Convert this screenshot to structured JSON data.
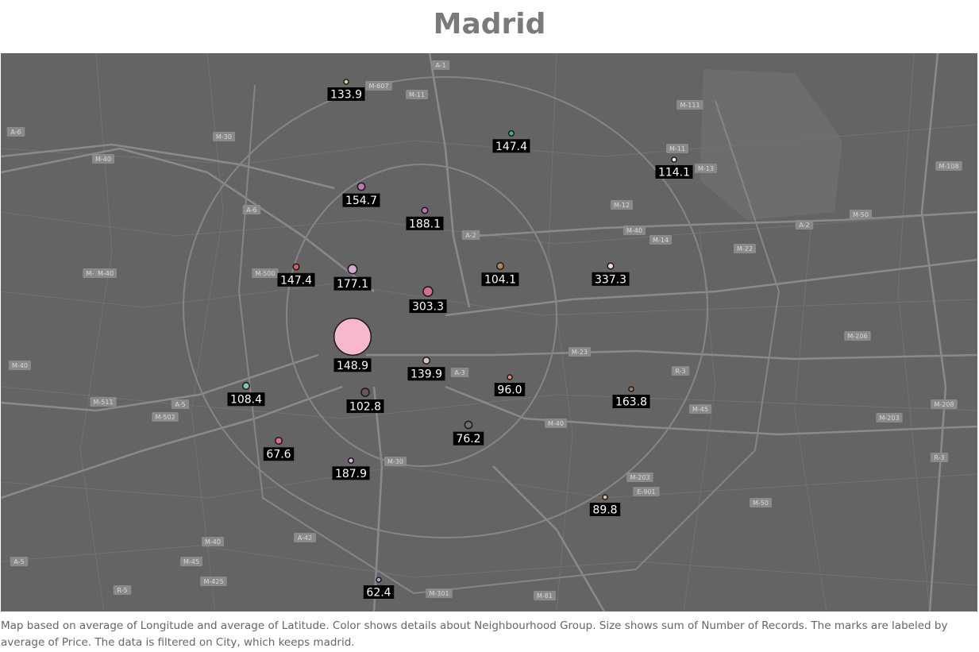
{
  "title": "Madrid",
  "caption": "Map based on average of Longitude and average of Latitude.  Color shows details about Neighbourhood Group.  Size shows sum of Number of Records.  The marks are labeled by average of Price. The data is filtered on City, which keeps madrid.",
  "colors": {
    "map_background": "#646464",
    "label_background": "#000000",
    "label_text": "#ffffff",
    "title_text": "#7a7a7a"
  },
  "road_shields": [
    "A-1",
    "M-607",
    "M-11",
    "M-30",
    "M-40",
    "A-6",
    "M-111",
    "M-11",
    "M-13",
    "M-108",
    "M-12",
    "M-40",
    "A-2",
    "M-14",
    "M-22",
    "A-2",
    "M-50",
    "M-500",
    "M-503",
    "A-6",
    "A-2",
    "M-23",
    "M-206",
    "R-3",
    "M-40",
    "A-3",
    "M-511",
    "A-5",
    "M-502",
    "M-45",
    "M-203",
    "M-208",
    "M-30",
    "M-40",
    "R-3",
    "M-203",
    "E-901",
    "A-42",
    "M-40",
    "M-50",
    "A-5",
    "M-45",
    "M-425",
    "R-5",
    "M-301",
    "M-81",
    "M-40"
  ],
  "marks": [
    {
      "label": "133.9",
      "color": "#e8c9a8",
      "records": 2
    },
    {
      "label": "147.4",
      "color": "#3ab5a2",
      "records": 3
    },
    {
      "label": "114.1",
      "color": "#f2f2f2",
      "records": 2
    },
    {
      "label": "154.7",
      "color": "#c07ab0",
      "records": 6
    },
    {
      "label": "188.1",
      "color": "#b677a6",
      "records": 4
    },
    {
      "label": "147.4",
      "color": "#e05a5a",
      "records": 4
    },
    {
      "label": "177.1",
      "color": "#d5a6d6",
      "records": 9
    },
    {
      "label": "104.1",
      "color": "#b5825c",
      "records": 5
    },
    {
      "label": "337.3",
      "color": "#fbd3e2",
      "records": 4
    },
    {
      "label": "303.3",
      "color": "#d66e8c",
      "records": 10
    },
    {
      "label": "148.9",
      "color": "#f7b8cc",
      "records": 150
    },
    {
      "label": "139.9",
      "color": "#d8c6bc",
      "records": 5
    },
    {
      "label": "96.0",
      "color": "#f08a78",
      "records": 1
    },
    {
      "label": "163.8",
      "color": "#b07a55",
      "records": 1
    },
    {
      "label": "108.4",
      "color": "#7cc8b6",
      "records": 5
    },
    {
      "label": "102.8",
      "color": "#6a5a55",
      "records": 7
    },
    {
      "label": "76.2",
      "color": "#6e6e6e",
      "records": 6
    },
    {
      "label": "67.6",
      "color": "#e06a88",
      "records": 5
    },
    {
      "label": "187.9",
      "color": "#e3b4e6",
      "records": 3
    },
    {
      "label": "89.8",
      "color": "#f2b8a0",
      "records": 1
    },
    {
      "label": "62.4",
      "color": "#9fb0e8",
      "records": 2
    }
  ]
}
